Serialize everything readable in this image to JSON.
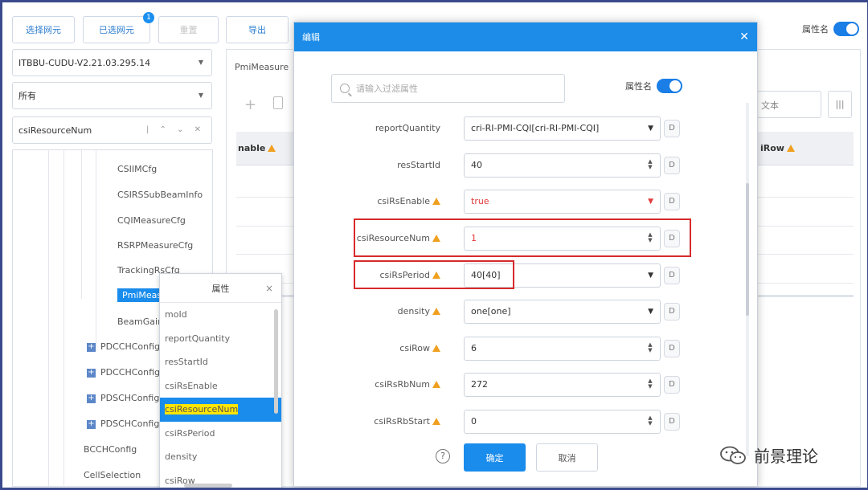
{
  "toolbar": {
    "select_network_element": "选择网元",
    "selected_network_element": "已选网元",
    "selected_badge": "1",
    "reset": "重置",
    "export": "导出"
  },
  "top_right": {
    "attr_name_toggle_label": "属性名"
  },
  "left": {
    "version_select": "ITBBU-CUDU-V2.21.03.295.14",
    "scope_select": "所有",
    "search_value": "csiResourceNum",
    "search_tools": "| ⌃ ⌄ ✕"
  },
  "tree": {
    "items": [
      "CSIIMCfg",
      "CSIRSSubBeamInfo",
      "CQIMeasureCfg",
      "RSRPMeasureCfg",
      "TrackingRsCfg",
      "PmiMeasure",
      "BeamGain",
      "PDCCHConfig",
      "PDCCHConfigC",
      "PDSCHConfig",
      "PDSCHConfigC",
      "BCCHConfig",
      "CellSelection"
    ]
  },
  "grid": {
    "tab": "PmiMeasure",
    "col_enable": "nable",
    "col_row": "iRow",
    "search_stub": "文本"
  },
  "attr_popup": {
    "title": "属性",
    "items": [
      "moId",
      "reportQuantity",
      "resStartId",
      "csiRsEnable",
      "csiResourceNum",
      "csiRsPeriod",
      "density",
      "csiRow"
    ]
  },
  "modal": {
    "title": "编辑",
    "filter_placeholder": "请输入过滤属性",
    "attr_name_toggle_label": "属性名",
    "rows": [
      {
        "label": "reportQuantity",
        "value": "cri-RI-PMI-CQI[cri-RI-PMI-CQI]",
        "type": "select"
      },
      {
        "label": "resStartId",
        "value": "40",
        "type": "spin"
      },
      {
        "label": "csiRsEnable",
        "value": "true",
        "type": "select"
      },
      {
        "label": "csiResourceNum",
        "value": "1",
        "type": "spin"
      },
      {
        "label": "csiRsPeriod",
        "value": "40[40]",
        "type": "select"
      },
      {
        "label": "density",
        "value": "one[one]",
        "type": "select"
      },
      {
        "label": "csiRow",
        "value": "6",
        "type": "spin"
      },
      {
        "label": "csiRsRbNum",
        "value": "272",
        "type": "spin"
      },
      {
        "label": "csiRsRbStart",
        "value": "0",
        "type": "spin"
      }
    ],
    "d_button": "D",
    "help": "?",
    "ok": "确定",
    "cancel": "取消"
  },
  "watermark": "前景理论",
  "colors": {
    "accent": "#1a8cec",
    "highlight": "#d62b2b",
    "warning": "#f0a020",
    "required": "#e23b3b"
  }
}
